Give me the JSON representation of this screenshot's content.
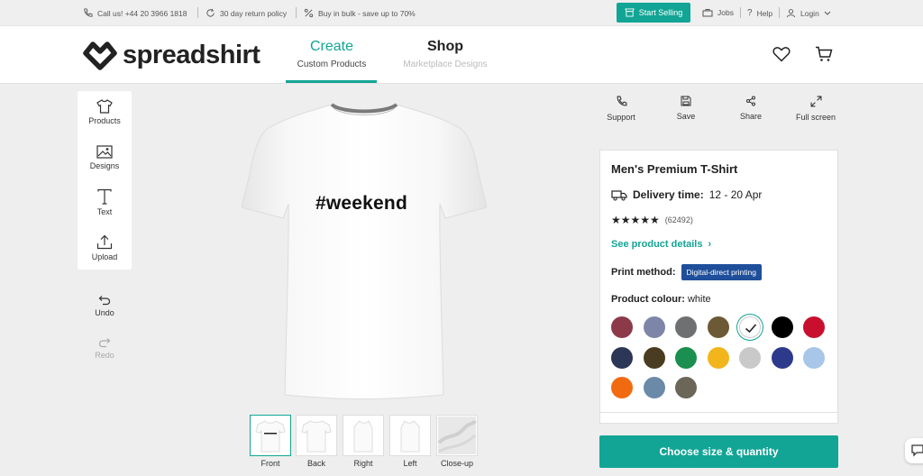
{
  "topbar": {
    "call": "Call us! +44 20 3966 1818",
    "returns": "30 day return policy",
    "bulk": "Buy in bulk - save up to 70%",
    "start_selling": "Start Selling",
    "jobs": "Jobs",
    "help": "Help",
    "login": "Login"
  },
  "header": {
    "logo": "spreadshirt",
    "nav": [
      {
        "title": "Create",
        "sub": "Custom Products"
      },
      {
        "title": "Shop",
        "sub": "Marketplace Designs"
      }
    ],
    "icons": [
      "heart-icon",
      "cart-icon"
    ]
  },
  "tools": {
    "products": "Products",
    "designs": "Designs",
    "text": "Text",
    "upload": "Upload",
    "undo": "Undo",
    "redo": "Redo"
  },
  "design": {
    "text": "#weekend"
  },
  "views": [
    "Front",
    "Back",
    "Right",
    "Left",
    "Close-up"
  ],
  "actions": {
    "support": "Support",
    "save": "Save",
    "share": "Share",
    "fullscreen": "Full screen"
  },
  "product": {
    "title": "Men's Premium T-Shirt",
    "delivery_label": "Delivery time:",
    "delivery_value": "12 - 20 Apr",
    "stars": "★★★★★",
    "rating_count": "(62492)",
    "details_link": "See product details",
    "print_label": "Print method:",
    "print_value": "Digital-direct printing",
    "colour_label": "Product colour:",
    "colour_value": "white",
    "swatches": [
      "#8c3a4a",
      "#7d86a8",
      "#6f7072",
      "#6b5a35",
      "#ffffff",
      "#000000",
      "#c8102e",
      "#2c3656",
      "#4a3c20",
      "#1a8f4f",
      "#f2b51c",
      "#c9c9c9",
      "#2d3a8c",
      "#a7c6e8",
      "#f26a10",
      "#6b8aa8",
      "#6b6658"
    ],
    "selected_index": 4
  },
  "cta": "Choose size & quantity",
  "colors": {
    "accent": "#12a595",
    "badge": "#1f4f9b"
  }
}
